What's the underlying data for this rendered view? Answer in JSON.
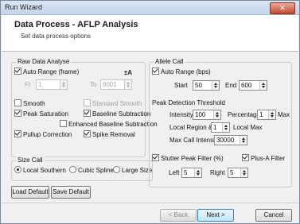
{
  "window": {
    "title": "Run Wizard",
    "close": "✕"
  },
  "header": {
    "title": "Data Process - AFLP Analysis",
    "subtitle": "Set data process options"
  },
  "raw": {
    "label": "Raw Data Analyse",
    "auto_range": "Auto Range (frame)",
    "auto_icon": "±A",
    "from_label": "Fr",
    "from_value": "1",
    "to_label": "To",
    "to_value": "8001",
    "smooth": "Smooth",
    "standard_smooth": "Standard Smooth",
    "peak_saturation": "Peak Saturation",
    "baseline_subtraction": "Baseline Subtraction",
    "enhanced_baseline": "Enhanced Baseline Subtraction",
    "pullup_correction": "Pullup Correction",
    "spike_removal": "Spike Removal"
  },
  "size": {
    "label": "Size Call",
    "local_southern": "Local Southern",
    "cubic_spline": "Cubic Spline",
    "large_size": "Large Size"
  },
  "allele": {
    "label": "Allele Call",
    "auto_range": "Auto Range (bps)",
    "start_label": "Start",
    "start_value": "50",
    "end_label": "End",
    "end_value": "600"
  },
  "peak": {
    "label": "Peak Detection Threshold",
    "intensity_label": "Intensity >",
    "intensity_value": "100",
    "percentage_label": "Percentage >",
    "percentage_value": "1",
    "max_label": "Max",
    "local_region_label": "Local Region & >",
    "local_region_value": "1",
    "local_max_label": "Local Max",
    "max_call_label": "Max Call Intensity",
    "max_call_value": "30000"
  },
  "stutter": {
    "label": "Stutter Peak Filter (%)",
    "plus_a": "Plus-A Filter",
    "left_label": "Left",
    "left_value": "5",
    "right_label": "Right",
    "right_value": "5"
  },
  "buttons": {
    "load_default": "Load Default",
    "save_default": "Save Default",
    "back": "< Back",
    "next": "Next >",
    "cancel": "Cancel"
  }
}
